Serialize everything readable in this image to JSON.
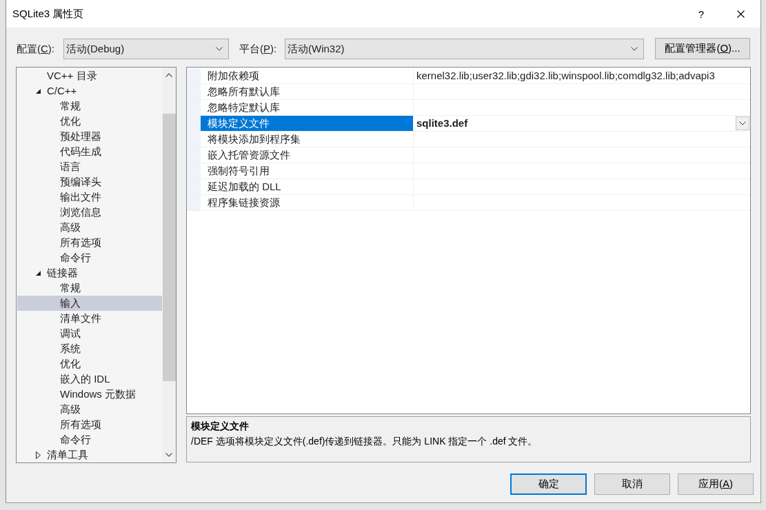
{
  "window": {
    "title": "SQLite3 属性页",
    "help": "?"
  },
  "config_bar": {
    "configuration": {
      "label": [
        "配置(",
        "C",
        "):"
      ],
      "value": "活动(Debug)"
    },
    "platform": {
      "label": [
        "平台(",
        "P",
        "):"
      ],
      "value": "活动(Win32)"
    },
    "manager_button": {
      "label": [
        "配置管理器(",
        "O",
        ")..."
      ]
    }
  },
  "tree": {
    "items": [
      {
        "kind": "leaf",
        "label": "VC++ 目录",
        "selected": false
      },
      {
        "kind": "group",
        "label": "C/C++",
        "expanded": true,
        "selected": false,
        "children": [
          {
            "kind": "leaf",
            "label": "常规",
            "selected": false
          },
          {
            "kind": "leaf",
            "label": "优化",
            "selected": false
          },
          {
            "kind": "leaf",
            "label": "预处理器",
            "selected": false
          },
          {
            "kind": "leaf",
            "label": "代码生成",
            "selected": false
          },
          {
            "kind": "leaf",
            "label": "语言",
            "selected": false
          },
          {
            "kind": "leaf",
            "label": "预编译头",
            "selected": false
          },
          {
            "kind": "leaf",
            "label": "输出文件",
            "selected": false
          },
          {
            "kind": "leaf",
            "label": "浏览信息",
            "selected": false
          },
          {
            "kind": "leaf",
            "label": "高级",
            "selected": false
          },
          {
            "kind": "leaf",
            "label": "所有选项",
            "selected": false
          },
          {
            "kind": "leaf",
            "label": "命令行",
            "selected": false
          }
        ]
      },
      {
        "kind": "group",
        "label": "链接器",
        "expanded": true,
        "selected": false,
        "children": [
          {
            "kind": "leaf",
            "label": "常规",
            "selected": false
          },
          {
            "kind": "leaf",
            "label": "输入",
            "selected": true
          },
          {
            "kind": "leaf",
            "label": "清单文件",
            "selected": false
          },
          {
            "kind": "leaf",
            "label": "调试",
            "selected": false
          },
          {
            "kind": "leaf",
            "label": "系统",
            "selected": false
          },
          {
            "kind": "leaf",
            "label": "优化",
            "selected": false
          },
          {
            "kind": "leaf",
            "label": "嵌入的 IDL",
            "selected": false
          },
          {
            "kind": "leaf",
            "label": "Windows 元数据",
            "selected": false
          },
          {
            "kind": "leaf",
            "label": "高级",
            "selected": false
          },
          {
            "kind": "leaf",
            "label": "所有选项",
            "selected": false
          },
          {
            "kind": "leaf",
            "label": "命令行",
            "selected": false
          }
        ]
      },
      {
        "kind": "group",
        "label": "清单工具",
        "expanded": false,
        "selected": false
      }
    ]
  },
  "property_grid": {
    "rows": [
      {
        "name": "附加依赖项",
        "selected": false,
        "value": {
          "text": "kernel32.lib;user32.lib;gdi32.lib;winspool.lib;comdlg32.lib;advapi3",
          "modified": false
        }
      },
      {
        "name": "忽略所有默认库",
        "selected": false
      },
      {
        "name": "忽略特定默认库",
        "selected": false
      },
      {
        "name": "模块定义文件",
        "selected": true,
        "value": {
          "text": "sqlite3.def",
          "modified": true
        }
      },
      {
        "name": "将模块添加到程序集",
        "selected": false
      },
      {
        "name": "嵌入托管资源文件",
        "selected": false
      },
      {
        "name": "强制符号引用",
        "selected": false
      },
      {
        "name": "延迟加载的 DLL",
        "selected": false
      },
      {
        "name": "程序集链接资源",
        "selected": false
      }
    ]
  },
  "description": {
    "title": "模块定义文件",
    "text": "/DEF 选项将模块定义文件(.def)传递到链接器。只能为 LINK 指定一个 .def 文件。"
  },
  "buttons": [
    {
      "label": "确定",
      "default": true
    },
    {
      "label": "取消",
      "default": false
    },
    {
      "label": [
        "应用(",
        "A",
        ")"
      ],
      "default": false
    }
  ]
}
